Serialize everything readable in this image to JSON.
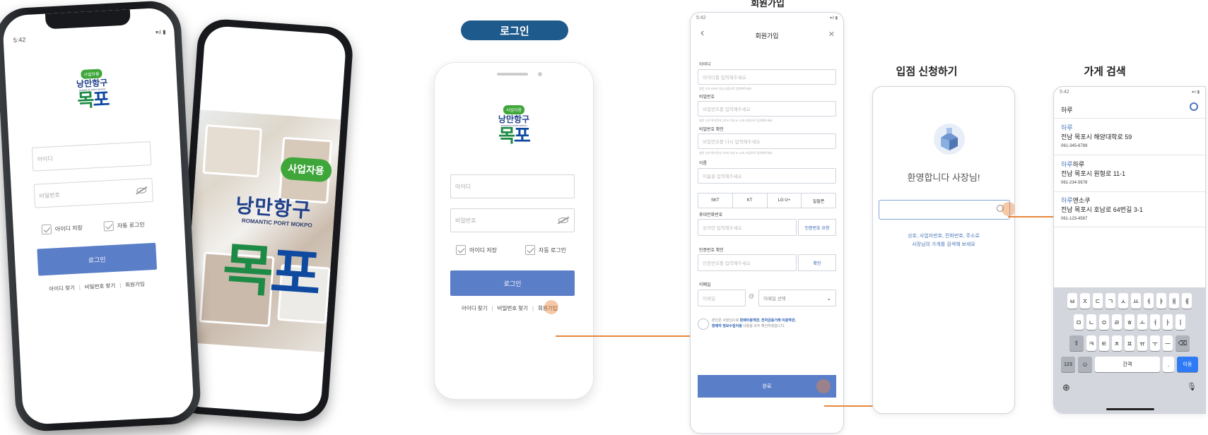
{
  "mockup": {
    "time": "5:42",
    "status_icons": "▾ıl ▮",
    "logo_tag": "사업자용",
    "logo_sub": "낭만항구",
    "logo_en": "ROMANTIC PORT MOKPO",
    "logo_main_a": "목",
    "logo_main_b": "포",
    "badge": "사업자용",
    "id_placeholder": "아이디",
    "pw_placeholder": "비밀번호",
    "save_id": "아이디 저장",
    "auto_login": "자동 로그인",
    "login_button": "로그인",
    "find_id": "아이디 찾기",
    "find_pw": "비밀번호 찾기",
    "signup": "회원가입",
    "separator": "|"
  },
  "flow": {
    "login_pill": "로그인",
    "signup_heading": "회원가입",
    "store_heading": "입점 신청하기",
    "search_heading": "가게 검색"
  },
  "signup_screen": {
    "time": "5:42",
    "status_icons": "▾ıl ▮",
    "back": "‹",
    "close": "✕",
    "title": "회원가입",
    "id_label": "아이디",
    "id_placeholder": "아이디를 입력해주세요",
    "id_hint": "영문 숫자 6자리 이상 조합으로 입력해주세요.",
    "pw_label": "비밀번호",
    "pw_placeholder": "비밀번호를 입력해주세요",
    "pw_hint": "영문 숫자 특수문자 2가지 이상 8~12자 조합으로 입력해주세요.",
    "pw2_label": "비밀번호 확인",
    "pw2_placeholder": "비밀번호를 다시 입력해주세요",
    "pw2_hint": "영문 숫자 특수문자 2가지 이상 8~12자 조합으로 입력해주세요.",
    "name_label": "이름",
    "name_placeholder": "이름을 입력해주세요",
    "carriers": [
      "SKT",
      "KT",
      "LG U+",
      "알뜰폰"
    ],
    "phone_label": "휴대전화번호",
    "phone_placeholder": "숫자만 입력해주세요",
    "phone_button": "인증번호 요청",
    "code_label": "인증번호 확인",
    "code_placeholder": "인증번호를 입력해주세요",
    "code_button": "확인",
    "email_label": "이메일",
    "email_placeholder": "이메일",
    "at": "@",
    "email_domain": "이메일 선택",
    "agree_pre": "본인은 사장님으로 ",
    "agree_terms1": "판매이용약관, 전자금융거래 이용약관,",
    "agree_terms2": "판매자 정보수집이용",
    "agree_post": " 내용을 모두 확인하였습니다.",
    "done": "완료"
  },
  "store_screen": {
    "welcome": "환영합니다 사장님!",
    "hint_line1": "상호, 사업자번호, 전화번호, 주소로",
    "hint_line2": "사장님의 가게를 검색해 보세요",
    "store_icon": "store-icon"
  },
  "search_screen": {
    "time": "5:42",
    "status_icons": "▾ıl ▮",
    "query": "하루",
    "results": [
      {
        "hl": "하루",
        "rest": "",
        "addr": "전남 목포시 해양대학로 59",
        "phone": "061-345-6789"
      },
      {
        "hl": "하루",
        "rest": "하루",
        "addr": "전남 목포시 원형로 11-1",
        "phone": "061-234-5678"
      },
      {
        "hl": "하루",
        "rest": "앤소쿠",
        "addr": "전남 목포시 호남로 64번길 3-1",
        "phone": "061-123-4567"
      }
    ],
    "kb_row1": [
      "ㅂ",
      "ㅈ",
      "ㄷ",
      "ㄱ",
      "ㅅ",
      "ㅛ",
      "ㅕ",
      "ㅑ",
      "ㅐ",
      "ㅔ"
    ],
    "kb_row2": [
      "ㅁ",
      "ㄴ",
      "ㅇ",
      "ㄹ",
      "ㅎ",
      "ㅗ",
      "ㅓ",
      "ㅏ",
      "ㅣ"
    ],
    "kb_row3": [
      "ㅋ",
      "ㅌ",
      "ㅊ",
      "ㅍ",
      "ㅠ",
      "ㅜ",
      "ㅡ"
    ],
    "shift": "⇧",
    "backspace": "⌫",
    "num": "123",
    "emoji": "☺",
    "space": "간격",
    "period": ".",
    "go": "이동",
    "globe": "⊕",
    "mic": "🎙"
  }
}
